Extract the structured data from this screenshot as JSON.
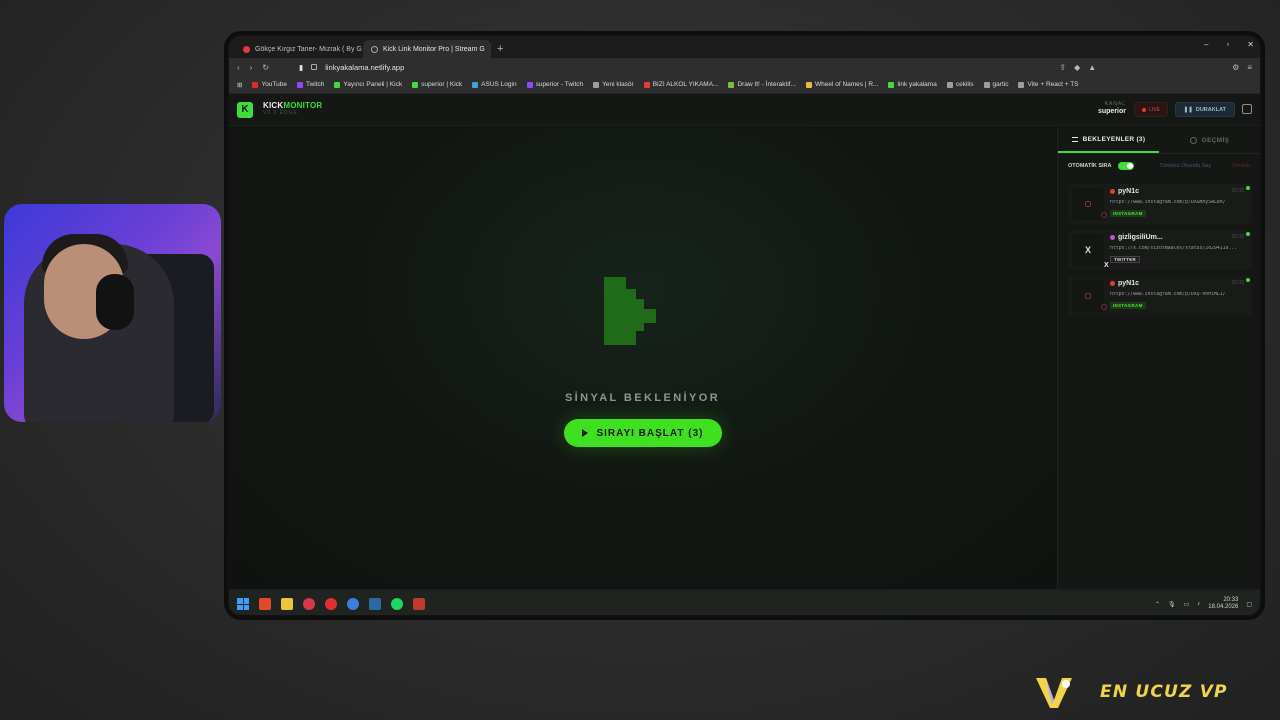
{
  "browser": {
    "tabs": [
      {
        "label": "Gökçe Kırgız Taner- Mızrak ( By G"
      },
      {
        "label": "Kick Link Monitor Pro | Stream G"
      }
    ],
    "url": "linkyakalama.netlify.app",
    "bookmarks": [
      {
        "label": "YouTube",
        "color": "#e02a2a"
      },
      {
        "label": "Twitch",
        "color": "#9146ff"
      },
      {
        "label": "Yayıncı Paneli | Kick",
        "color": "#3fdc3b"
      },
      {
        "label": "superior | Kick",
        "color": "#3fdc3b"
      },
      {
        "label": "ASUS Login",
        "color": "#38a6d6"
      },
      {
        "label": "superior - Twitch",
        "color": "#9146ff"
      },
      {
        "label": "Yeni klasör",
        "color": "#9aa19a"
      },
      {
        "label": "BIZI ALKOL YIKAMA...",
        "color": "#e03c3c"
      },
      {
        "label": "Draw It! - İnteraktif...",
        "color": "#7bbf3a"
      },
      {
        "label": "Wheel of Names | R...",
        "color": "#e8b93a"
      },
      {
        "label": "link yakalama",
        "color": "#3fdc3b"
      },
      {
        "label": "cekilis",
        "color": "#9aa19a"
      },
      {
        "label": "gartic",
        "color": "#9aa19a"
      },
      {
        "label": "Vite + React + TS",
        "color": "#9aa19a"
      }
    ]
  },
  "app": {
    "brand_kick": "KICK",
    "brand_monitor": "MONITOR",
    "logo_letter": "K",
    "version": "V3.0 EDGE",
    "channel_label": "KANAL",
    "channel_value": "superior",
    "live_label": "LIVE",
    "pause_label": "DURAKLAT",
    "signal_text": "SİNYAL BEKLENİYOR",
    "start_label": "SIRAYI BAŞLAT (3)",
    "accent": "#3fdc3b"
  },
  "panel": {
    "tab_waiting": "BEKLEYENLER (3)",
    "tab_history": "GEÇMİŞ",
    "auto_label": "OTOMATİK SIRA",
    "mark_all": "Tümünü Okundu Say",
    "clear": "Temizle",
    "items": [
      {
        "user": "pyN1c",
        "time": "20:33",
        "link": "https://www.instagram.com/p/DXGmnySALeh/",
        "tag": "INSTAGRAM"
      },
      {
        "user": "gizligsiliUm...",
        "time": "20:33",
        "link": "https://x.com/sizotmaalex/status/20294119...",
        "tag": "TWITTER"
      },
      {
        "user": "pyN1c",
        "time": "20:33",
        "link": "https://www.instagram.com/p/DXQ-nnHiML1/",
        "tag": "INSTAGRAM"
      }
    ]
  },
  "taskbar": {
    "time": "20:33",
    "date": "18.04.2026"
  },
  "overlay": {
    "sponsor_text": "EN UCUZ VP"
  }
}
